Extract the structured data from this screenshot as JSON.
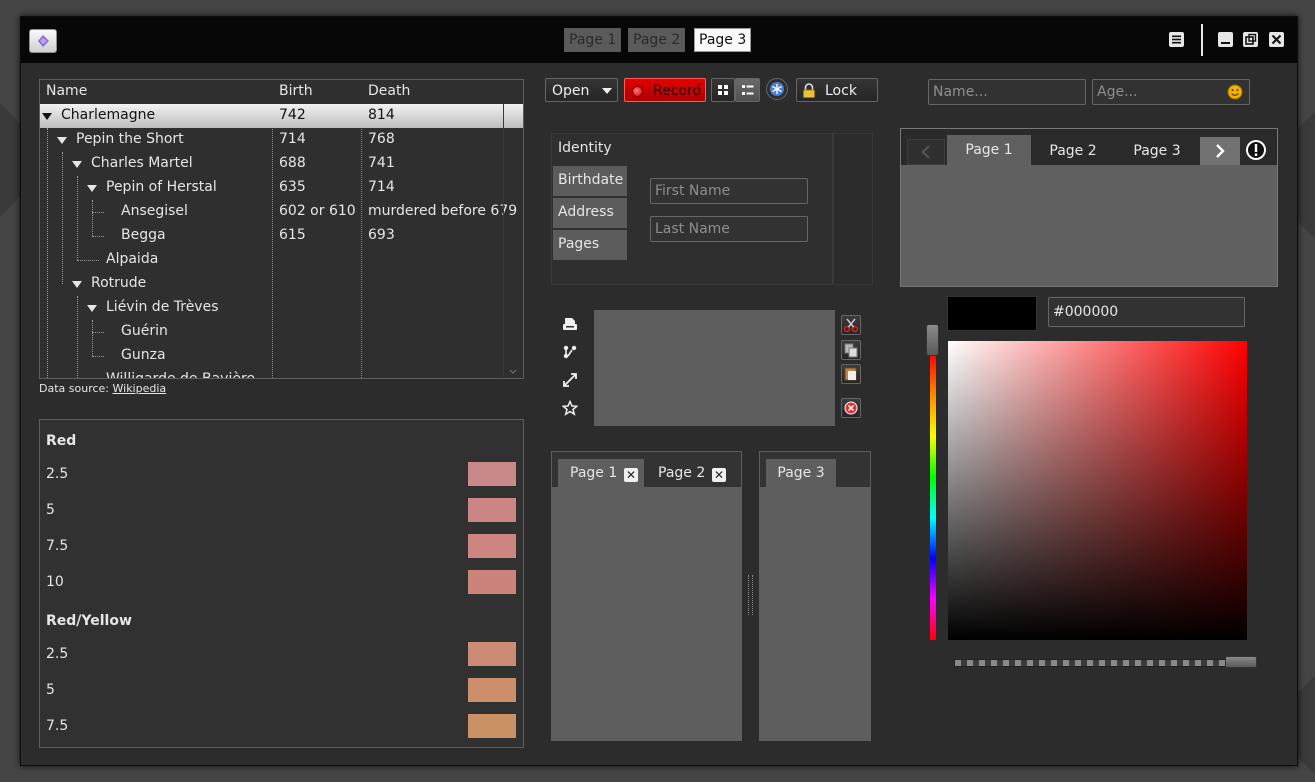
{
  "window": {
    "tabs": [
      {
        "label": "Page 1",
        "active": false
      },
      {
        "label": "Page 2",
        "active": false
      },
      {
        "label": "Page 3",
        "active": true
      }
    ]
  },
  "tree": {
    "columns": [
      "Name",
      "Birth",
      "Death"
    ],
    "rows": [
      {
        "name": "Charlemagne",
        "birth": "742",
        "death": "814",
        "depth": 0,
        "expanded": true,
        "selected": true
      },
      {
        "name": "Pepin the Short",
        "birth": "714",
        "death": "768",
        "depth": 1,
        "expanded": true
      },
      {
        "name": "Charles Martel",
        "birth": "688",
        "death": "741",
        "depth": 2,
        "expanded": true
      },
      {
        "name": "Pepin of Herstal",
        "birth": "635",
        "death": "714",
        "depth": 3,
        "expanded": true
      },
      {
        "name": "Ansegisel",
        "birth": "602 or 610",
        "death": "murdered before 679",
        "depth": 4
      },
      {
        "name": "Begga",
        "birth": "615",
        "death": "693",
        "depth": 4
      },
      {
        "name": "Alpaida",
        "birth": "",
        "death": "",
        "depth": 3
      },
      {
        "name": "Rotrude",
        "birth": "",
        "death": "",
        "depth": 2,
        "expanded": true
      },
      {
        "name": "Liévin de Trèves",
        "birth": "",
        "death": "",
        "depth": 3,
        "expanded": true
      },
      {
        "name": "Guérin",
        "birth": "",
        "death": "",
        "depth": 4
      },
      {
        "name": "Gunza",
        "birth": "",
        "death": "",
        "depth": 4
      },
      {
        "name": "Willigarde de Bavière",
        "birth": "",
        "death": "",
        "depth": 3
      }
    ],
    "source_label": "Data source:",
    "source_link": "Wikipedia"
  },
  "colors": {
    "groups": [
      {
        "title": "Red",
        "items": [
          {
            "label": "2.5",
            "color": "#c98888"
          },
          {
            "label": "5",
            "color": "#cb8585"
          },
          {
            "label": "7.5",
            "color": "#cc8580"
          },
          {
            "label": "10",
            "color": "#cc847a"
          }
        ]
      },
      {
        "title": "Red/Yellow",
        "items": [
          {
            "label": "2.5",
            "color": "#cb8a74"
          },
          {
            "label": "5",
            "color": "#cc8e6b"
          },
          {
            "label": "7.5",
            "color": "#cb9166"
          }
        ]
      }
    ]
  },
  "toolbar": {
    "open_label": "Open",
    "record_label": "Record",
    "lock_label": "Lock"
  },
  "identity": {
    "tabs": [
      "Identity",
      "Birthdate",
      "Address",
      "Pages"
    ],
    "first_name_placeholder": "First Name",
    "last_name_placeholder": "Last Name"
  },
  "split_tabs": {
    "left": [
      "Page 1",
      "Page 2"
    ],
    "right": [
      "Page 3"
    ]
  },
  "right": {
    "name_placeholder": "Name...",
    "age_placeholder": "Age...",
    "tabs": [
      "Page 1",
      "Page 2",
      "Page 3"
    ],
    "hex_value": "#000000"
  },
  "palette": {
    "accent": "#cc0000",
    "window_bg": "#2c2c2c"
  }
}
